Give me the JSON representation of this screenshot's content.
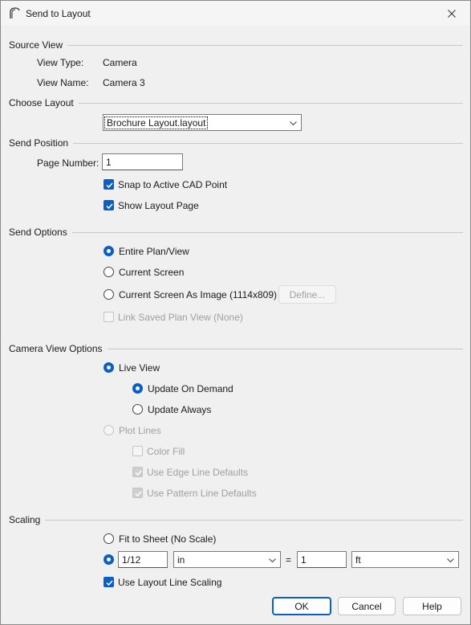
{
  "window": {
    "title": "Send to Layout"
  },
  "source_view": {
    "heading": "Source View",
    "view_type_label": "View Type:",
    "view_type_value": "Camera",
    "view_name_label": "View Name:",
    "view_name_value": "Camera 3"
  },
  "choose_layout": {
    "heading": "Choose Layout",
    "selected": "Brochure Layout.layout"
  },
  "send_position": {
    "heading": "Send Position",
    "page_number_label": "Page Number:",
    "page_number_value": "1",
    "snap_label": "Snap to Active CAD Point",
    "snap_checked": true,
    "show_page_label": "Show Layout Page",
    "show_page_checked": true
  },
  "send_options": {
    "heading": "Send Options",
    "entire_label": "Entire Plan/View",
    "current_screen_label": "Current Screen",
    "current_as_image_label": "Current Screen As Image (1114x809)",
    "define_button": "Define...",
    "link_saved_label": "Link Saved Plan View (None)",
    "selected": "Entire Plan/View"
  },
  "camera_view_options": {
    "heading": "Camera View Options",
    "live_view_label": "Live View",
    "update_on_demand_label": "Update On Demand",
    "update_always_label": "Update Always",
    "plot_lines_label": "Plot Lines",
    "color_fill_label": "Color Fill",
    "edge_defaults_label": "Use Edge Line Defaults",
    "pattern_defaults_label": "Use Pattern Line Defaults"
  },
  "scaling": {
    "heading": "Scaling",
    "fit_label": "Fit to Sheet (No Scale)",
    "scale_left_value": "1/12",
    "scale_left_unit": "in",
    "equals": "=",
    "scale_right_value": "1",
    "scale_right_unit": "ft",
    "line_scaling_label": "Use Layout Line Scaling",
    "line_scaling_checked": true
  },
  "buttons": {
    "ok": "OK",
    "cancel": "Cancel",
    "help": "Help"
  },
  "colors": {
    "accent": "#0a5fc4",
    "disabled_text": "#a0a0a0"
  }
}
